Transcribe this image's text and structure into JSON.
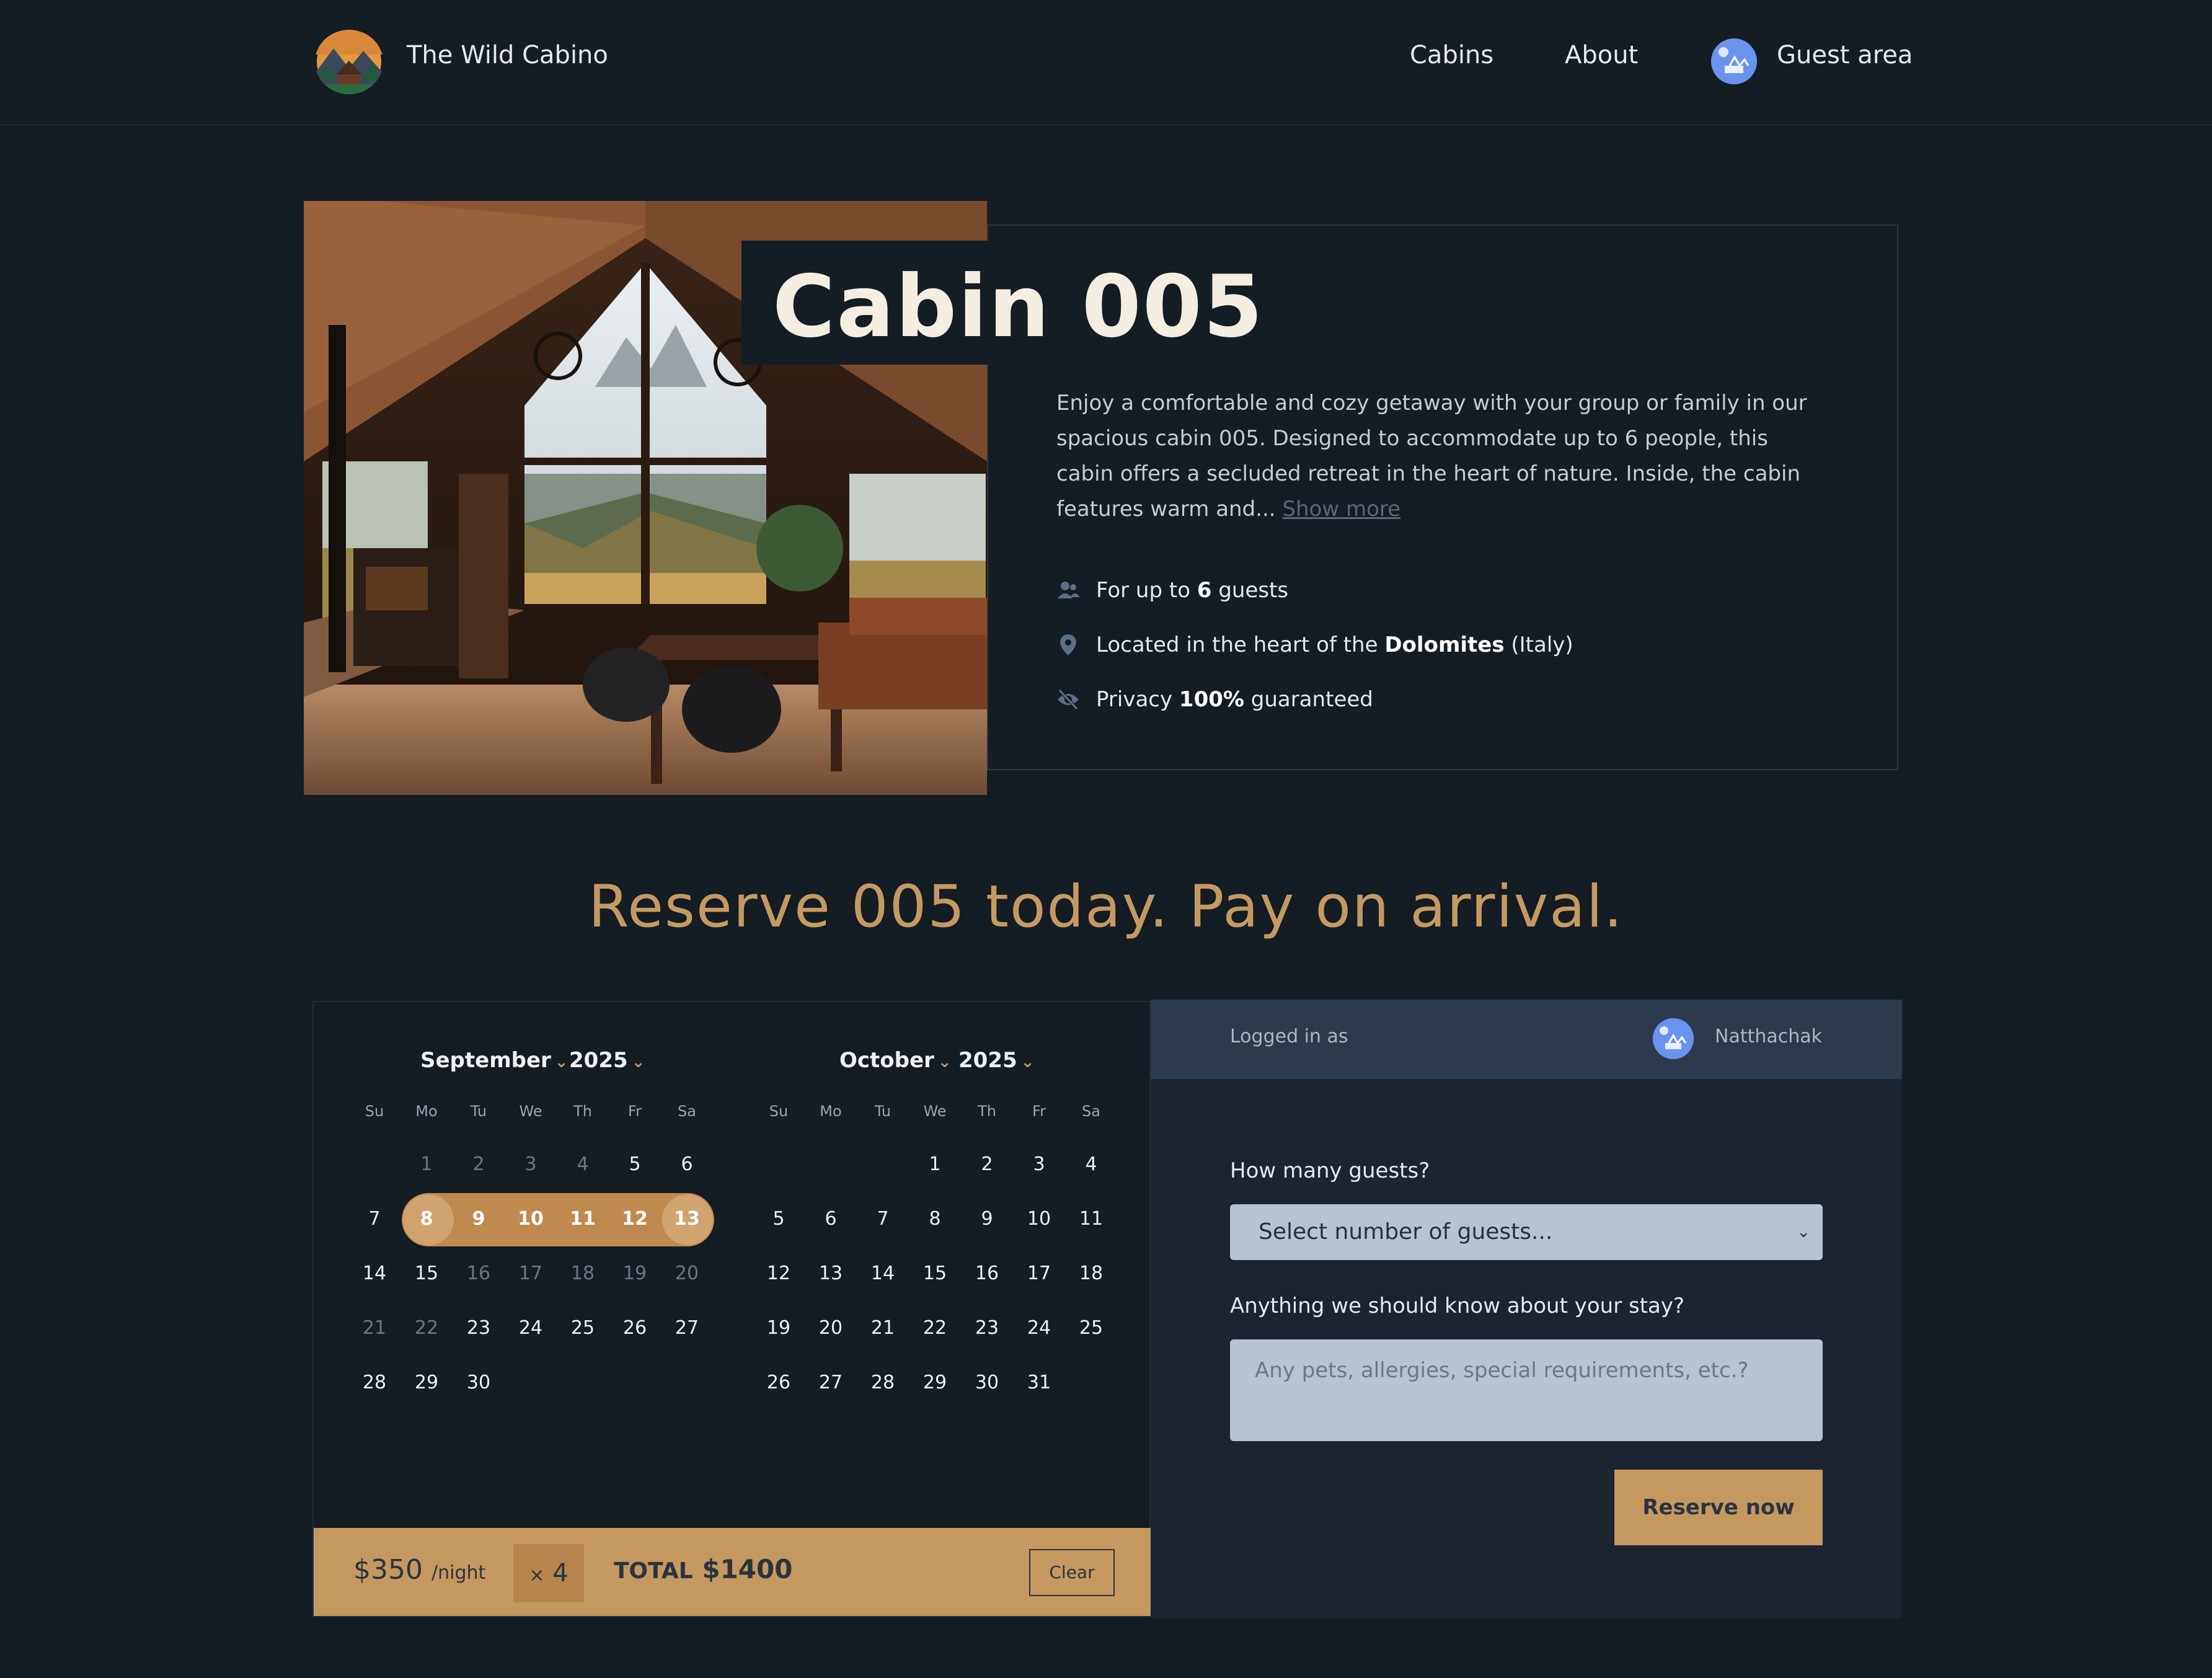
{
  "header": {
    "brand": "The Wild Cabino",
    "nav": {
      "cabins": "Cabins",
      "about": "About",
      "guest_area": "Guest area"
    }
  },
  "hero": {
    "title": "Cabin 005",
    "description": "Enjoy a comfortable and cozy getaway with your group or family in our spacious cabin 005. Designed to accommodate up to 6 people, this cabin offers a secluded retreat in the heart of nature. Inside, the cabin features warm and...",
    "show_more": "Show more",
    "features": {
      "guests": {
        "pre": "For up to",
        "bold": "6",
        "post": "guests"
      },
      "location": {
        "pre": "Located in the heart of the",
        "bold": "Dolomites",
        "post": "(Italy)"
      },
      "privacy": {
        "pre": "Privacy",
        "bold": "100%",
        "post": "guaranteed"
      }
    }
  },
  "reserve_heading": "Reserve 005 today. Pay on arrival.",
  "calendar": {
    "weekdays": [
      "Su",
      "Mo",
      "Tu",
      "We",
      "Th",
      "Fr",
      "Sa"
    ],
    "months": [
      {
        "name": "September",
        "year": "2025",
        "weeks": [
          [
            "",
            "1",
            "2",
            "3",
            "4",
            "5",
            "6"
          ],
          [
            "7",
            "8",
            "9",
            "10",
            "11",
            "12",
            "13"
          ],
          [
            "14",
            "15",
            "16",
            "17",
            "18",
            "19",
            "20"
          ],
          [
            "21",
            "22",
            "23",
            "24",
            "25",
            "26",
            "27"
          ],
          [
            "28",
            "29",
            "30",
            "",
            "",
            "",
            ""
          ]
        ]
      },
      {
        "name": "October",
        "year": "2025",
        "weeks": [
          [
            "",
            "",
            "",
            "1",
            "2",
            "3",
            "4"
          ],
          [
            "5",
            "6",
            "7",
            "8",
            "9",
            "10",
            "11"
          ],
          [
            "12",
            "13",
            "14",
            "15",
            "16",
            "17",
            "18"
          ],
          [
            "19",
            "20",
            "21",
            "22",
            "23",
            "24",
            "25"
          ],
          [
            "26",
            "27",
            "28",
            "29",
            "30",
            "31",
            ""
          ]
        ]
      }
    ],
    "selected_range": {
      "month": "September",
      "start": 8,
      "end": 13
    }
  },
  "price_bar": {
    "price": "$350",
    "per_night": "/night",
    "multiplier_symbol": "×",
    "nights": "4",
    "total_label": "TOTAL",
    "total": "$1400",
    "clear": "Clear"
  },
  "form": {
    "logged_in_label": "Logged in as",
    "user_name": "Natthachak",
    "guests_label": "How many guests?",
    "guests_placeholder": "Select number of guests...",
    "notes_label": "Anything we should know about your stay?",
    "notes_placeholder": "Any pets, allergies, special requirements, etc.?",
    "submit": "Reserve now"
  },
  "colors": {
    "background": "#141c24",
    "accent": "#c59a62",
    "panel": "#1b2430",
    "login_bar": "#2c3a4c",
    "input": "#b6c3d3"
  }
}
